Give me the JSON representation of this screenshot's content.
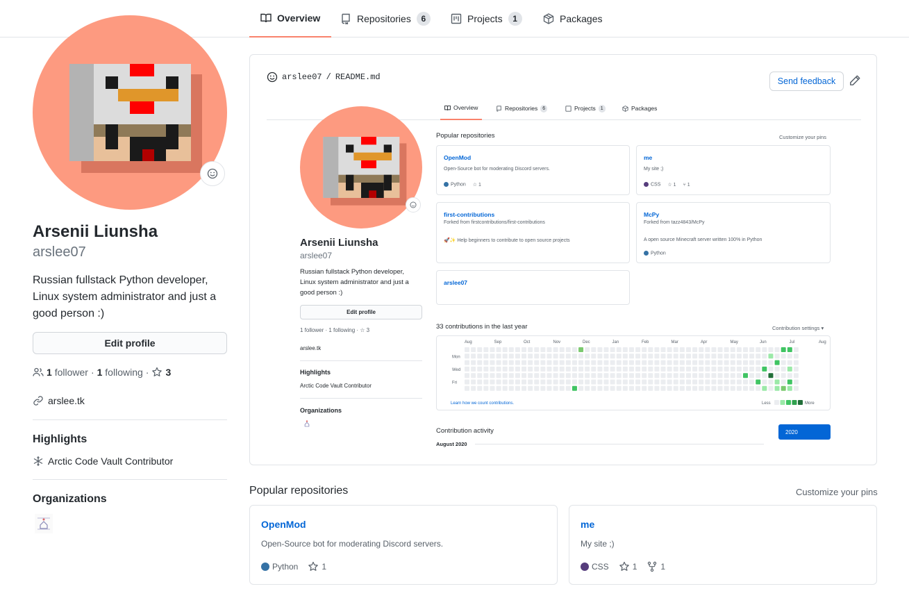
{
  "nav": {
    "tabs": [
      {
        "label": "Overview",
        "icon": "book-icon",
        "active": true
      },
      {
        "label": "Repositories",
        "icon": "repo-icon",
        "count": "6"
      },
      {
        "label": "Projects",
        "icon": "project-icon",
        "count": "1"
      },
      {
        "label": "Packages",
        "icon": "package-icon"
      }
    ]
  },
  "profile": {
    "full_name": "Arsenii Liunsha",
    "username": "arslee07",
    "bio": "Russian fullstack Python developer, Linux system administrator and just a good person :)",
    "edit_label": "Edit profile",
    "followers_count": "1",
    "followers_label": "follower",
    "following_count": "1",
    "following_label": "following",
    "stars_count": "3",
    "website": "arslee.tk",
    "highlights_heading": "Highlights",
    "highlight_item": "Arctic Code Vault Contributor",
    "organizations_heading": "Organizations"
  },
  "readme": {
    "owner": "arslee07",
    "separator": "/",
    "file": "README.md",
    "feedback_label": "Send feedback",
    "mini": {
      "tabs": [
        {
          "label": "Overview"
        },
        {
          "label": "Repositories",
          "count": "6"
        },
        {
          "label": "Projects",
          "count": "1"
        },
        {
          "label": "Packages"
        }
      ],
      "name": "Arsenii Liunsha",
      "username": "arslee07",
      "bio": "Russian fullstack Python developer, Linux system administrator and just a good person :)",
      "edit_label": "Edit profile",
      "follow_line": "1 follower · 1 following · ☆ 3",
      "website": "arslee.tk",
      "highlights_heading": "Highlights",
      "highlight_item": "Arctic Code Vault Contributor",
      "organizations_heading": "Organizations",
      "popular_heading": "Popular repositories",
      "customize": "Customize your pins",
      "repos": [
        {
          "title": "OpenMod",
          "desc": "Open-Source bot for moderating Discord servers.",
          "lang": "Python",
          "lang_color": "#3572A5",
          "stars": "1"
        },
        {
          "title": "me",
          "desc": "My site ;)",
          "lang": "CSS",
          "lang_color": "#563d7c",
          "stars": "1",
          "forks": "1"
        },
        {
          "title": "first-contributions",
          "desc": "Forked from firstcontributions/first-contributions",
          "desc2": "🚀✨ Help beginners to contribute to open source projects"
        },
        {
          "title": "McPy",
          "desc": "Forked from tazz4843/McPy",
          "desc2": "A open source Minecraft server written 100% in Python",
          "lang": "Python",
          "lang_color": "#3572A5"
        },
        {
          "title": "arslee07"
        }
      ],
      "contrib_heading": "33 contributions in the last year",
      "contrib_settings": "Contribution settings ▾",
      "months": [
        "Aug",
        "Sep",
        "Oct",
        "Nov",
        "Dec",
        "Jan",
        "Feb",
        "Mar",
        "Apr",
        "May",
        "Jun",
        "Jul",
        "Aug"
      ],
      "days": [
        "Mon",
        "Wed",
        "Fri"
      ],
      "learn": "Learn how we count contributions.",
      "less": "Less",
      "more": "More",
      "activity_heading": "Contribution activity",
      "activity_month": "August 2020",
      "year": "2020"
    }
  },
  "popular": {
    "heading": "Popular repositories",
    "customize": "Customize your pins",
    "repos": [
      {
        "title": "OpenMod",
        "desc": "Open-Source bot for moderating Discord servers.",
        "lang": "Python",
        "lang_color": "#3572A5",
        "stars": "1"
      },
      {
        "title": "me",
        "desc": "My site ;)",
        "lang": "CSS",
        "lang_color": "#563d7c",
        "stars": "1",
        "forks": "1"
      }
    ]
  },
  "colors": {
    "accent": "#f9826c",
    "avatar_bg": "#fd9a80",
    "link": "#0366d6"
  }
}
